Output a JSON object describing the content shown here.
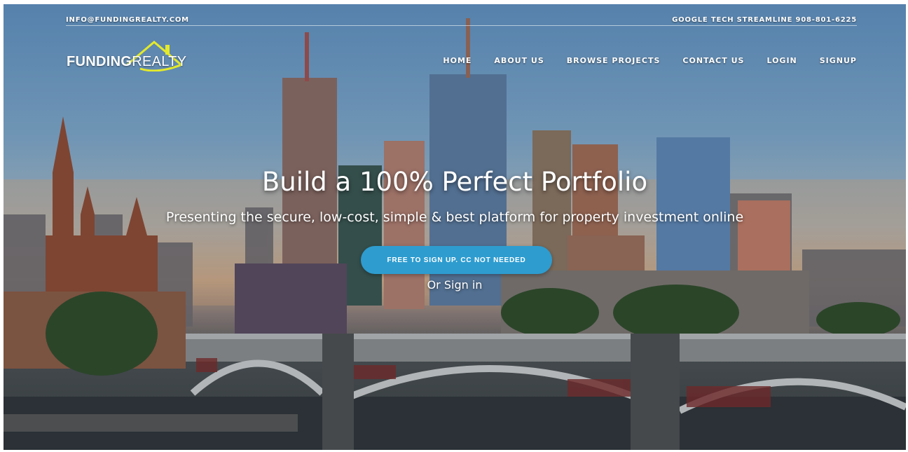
{
  "topbar": {
    "email": "INFO@FUNDINGREALTY.COM",
    "phone": "GOOGLE TECH STREAMLINE  908-801-6225"
  },
  "logo": {
    "part1": "FUNDING",
    "part2": "REALTY"
  },
  "nav": {
    "items": [
      {
        "label": "HOME"
      },
      {
        "label": "ABOUT US"
      },
      {
        "label": "BROWSE PROJECTS"
      },
      {
        "label": "CONTACT US"
      },
      {
        "label": "LOGIN"
      },
      {
        "label": "SIGNUP"
      }
    ]
  },
  "hero": {
    "headline": "Build a 100% Perfect Portfolio",
    "subline": "Presenting the secure, low-cost, simple & best platform for property investment online",
    "cta": "FREE TO SIGN UP. CC NOT NEEDED",
    "signin": "Or Sign in"
  },
  "colors": {
    "accent": "#2e9ccf",
    "logo_house": "#e4ea2a"
  }
}
